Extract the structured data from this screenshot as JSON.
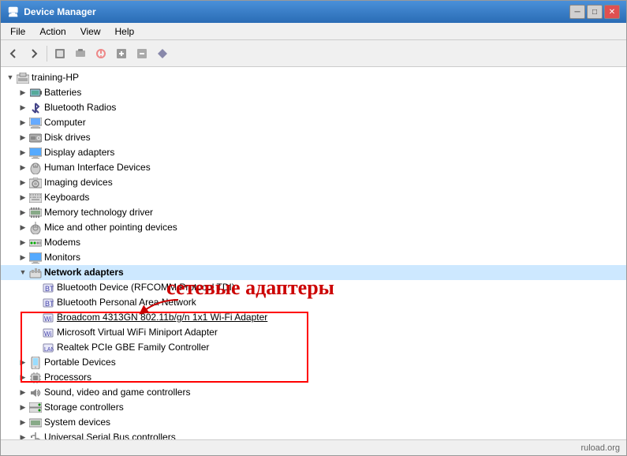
{
  "window": {
    "title": "Device Manager",
    "title_icon": "🖥",
    "controls": {
      "minimize": "─",
      "maximize": "□",
      "close": "✕"
    }
  },
  "menu": {
    "items": [
      "File",
      "Action",
      "View",
      "Help"
    ]
  },
  "toolbar": {
    "buttons": [
      "←",
      "→",
      "⬛",
      "⬛",
      "⬛",
      "⬛",
      "⬛",
      "⬛"
    ]
  },
  "tree": {
    "root": {
      "label": "training-HP",
      "children": [
        {
          "label": "Batteries",
          "icon": "🔋"
        },
        {
          "label": "Bluetooth Radios",
          "icon": "📶"
        },
        {
          "label": "Computer",
          "icon": "🖥"
        },
        {
          "label": "Disk drives",
          "icon": "💾"
        },
        {
          "label": "Display adapters",
          "icon": "🖥"
        },
        {
          "label": "Human Interface Devices",
          "icon": "🖱"
        },
        {
          "label": "Imaging devices",
          "icon": "📷"
        },
        {
          "label": "Keyboards",
          "icon": "⌨"
        },
        {
          "label": "Memory technology driver",
          "icon": "📂"
        },
        {
          "label": "Mice and other pointing devices",
          "icon": "🖱"
        },
        {
          "label": "Modems",
          "icon": "📡"
        },
        {
          "label": "Monitors",
          "icon": "🖥"
        },
        {
          "label": "Network adapters",
          "icon": "🌐",
          "expanded": true,
          "children": [
            {
              "label": "Bluetooth Device (RFCOMM Protocol TDI)",
              "icon": "📶"
            },
            {
              "label": "Bluetooth Personal Area Network",
              "icon": "📶"
            },
            {
              "label": "Broadcom 4313GN 802.11b/g/n 1x1 Wi-Fi Adapter",
              "icon": "📶",
              "underline": true
            },
            {
              "label": "Microsoft Virtual WiFi Miniport Adapter",
              "icon": "📶"
            },
            {
              "label": "Realtek PCIe GBE Family Controller",
              "icon": "📶"
            }
          ]
        },
        {
          "label": "Portable Devices",
          "icon": "📱"
        },
        {
          "label": "Processors",
          "icon": "⚙"
        },
        {
          "label": "Sound, video and game controllers",
          "icon": "🔊"
        },
        {
          "label": "Storage controllers",
          "icon": "💽"
        },
        {
          "label": "System devices",
          "icon": "⚙"
        },
        {
          "label": "Universal Serial Bus controllers",
          "icon": "🔌"
        }
      ]
    }
  },
  "annotation": {
    "text": "сетевые адаптеры"
  },
  "status": {
    "text": "ruload.org"
  }
}
